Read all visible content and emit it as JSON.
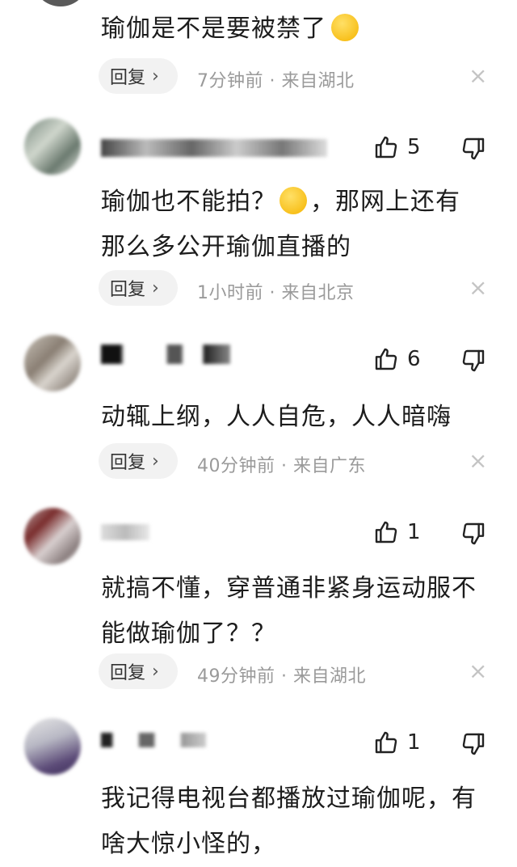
{
  "comments": [
    {
      "text_lines": [
        "瑜伽是不是要被禁了"
      ],
      "reply_label": "回复",
      "meta": "7分钟前 · 来自湖北"
    },
    {
      "text_lines": [
        "瑜伽也不能拍？",
        "，那网上还有",
        "那么多公开瑜伽直播的"
      ],
      "likes": "5",
      "reply_label": "回复",
      "meta": "1小时前 · 来自北京"
    },
    {
      "text_lines": [
        "动辄上纲，人人自危，人人暗嗨"
      ],
      "likes": "6",
      "reply_label": "回复",
      "meta": "40分钟前 · 来自广东"
    },
    {
      "text_lines": [
        "就搞不懂，穿普通非紧身运动服不",
        "能做瑜伽了？？"
      ],
      "likes": "1",
      "reply_label": "回复",
      "meta": "49分钟前 · 来自湖北"
    },
    {
      "text_lines": [
        "我记得电视台都播放过瑜伽呢，有",
        "啥大惊小怪的，"
      ],
      "likes": "1"
    }
  ],
  "icons": {
    "close": "×",
    "chevron": "›",
    "like": "thumbs-up-icon",
    "dislike": "thumbs-down-icon"
  }
}
